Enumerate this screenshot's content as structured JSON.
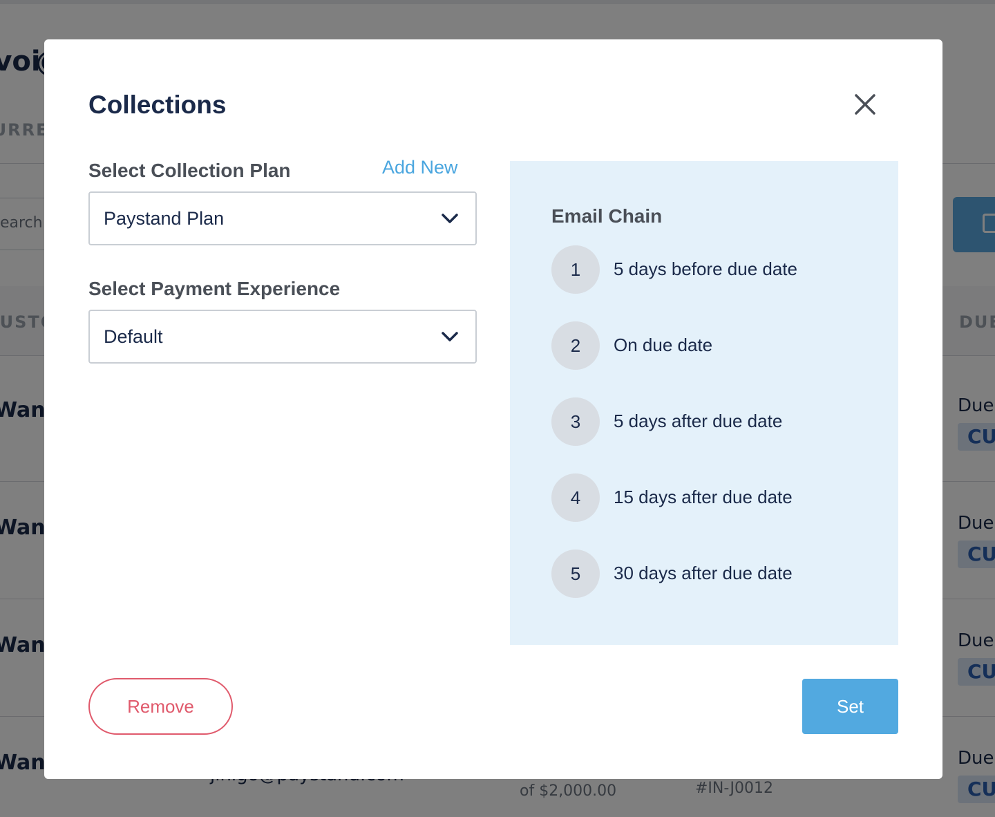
{
  "background": {
    "title": "Invoices",
    "tab": "CURRENT",
    "search_placeholder": "Search",
    "column_customer": "CUSTOMER",
    "column_due": "DUE",
    "rows": [
      {
        "name": "Wanda Dynamics",
        "due": "Due",
        "badge": "CU"
      },
      {
        "name": "Wanda Dynamics",
        "due": "Due",
        "badge": "CU"
      },
      {
        "name": "Wanda Dynamics",
        "due": "Due",
        "badge": "CU"
      },
      {
        "name": "Wanda Dynamics",
        "due": "Due",
        "badge": "CU"
      }
    ],
    "email": "jinigo@paystand.com",
    "amount": "of $2,000.00",
    "invoice": "#IN-J0012"
  },
  "modal": {
    "title": "Collections",
    "close_icon": "close-icon",
    "collection_plan_label": "Select Collection Plan",
    "add_new_label": "Add New",
    "collection_plan_value": "Paystand Plan",
    "payment_experience_label": "Select Payment Experience",
    "payment_experience_value": "Default",
    "email_chain": {
      "title": "Email Chain",
      "steps": [
        {
          "number": "1",
          "text": "5 days before due date"
        },
        {
          "number": "2",
          "text": "On due date"
        },
        {
          "number": "3",
          "text": "5 days after due date"
        },
        {
          "number": "4",
          "text": "15 days after due date"
        },
        {
          "number": "5",
          "text": "30 days after due date"
        }
      ]
    },
    "remove_label": "Remove",
    "set_label": "Set"
  },
  "colors": {
    "primary": "#52a9e0",
    "danger": "#e05a6c",
    "text_dark": "#1b2a4a",
    "panel_bg": "#e4f1fa"
  }
}
